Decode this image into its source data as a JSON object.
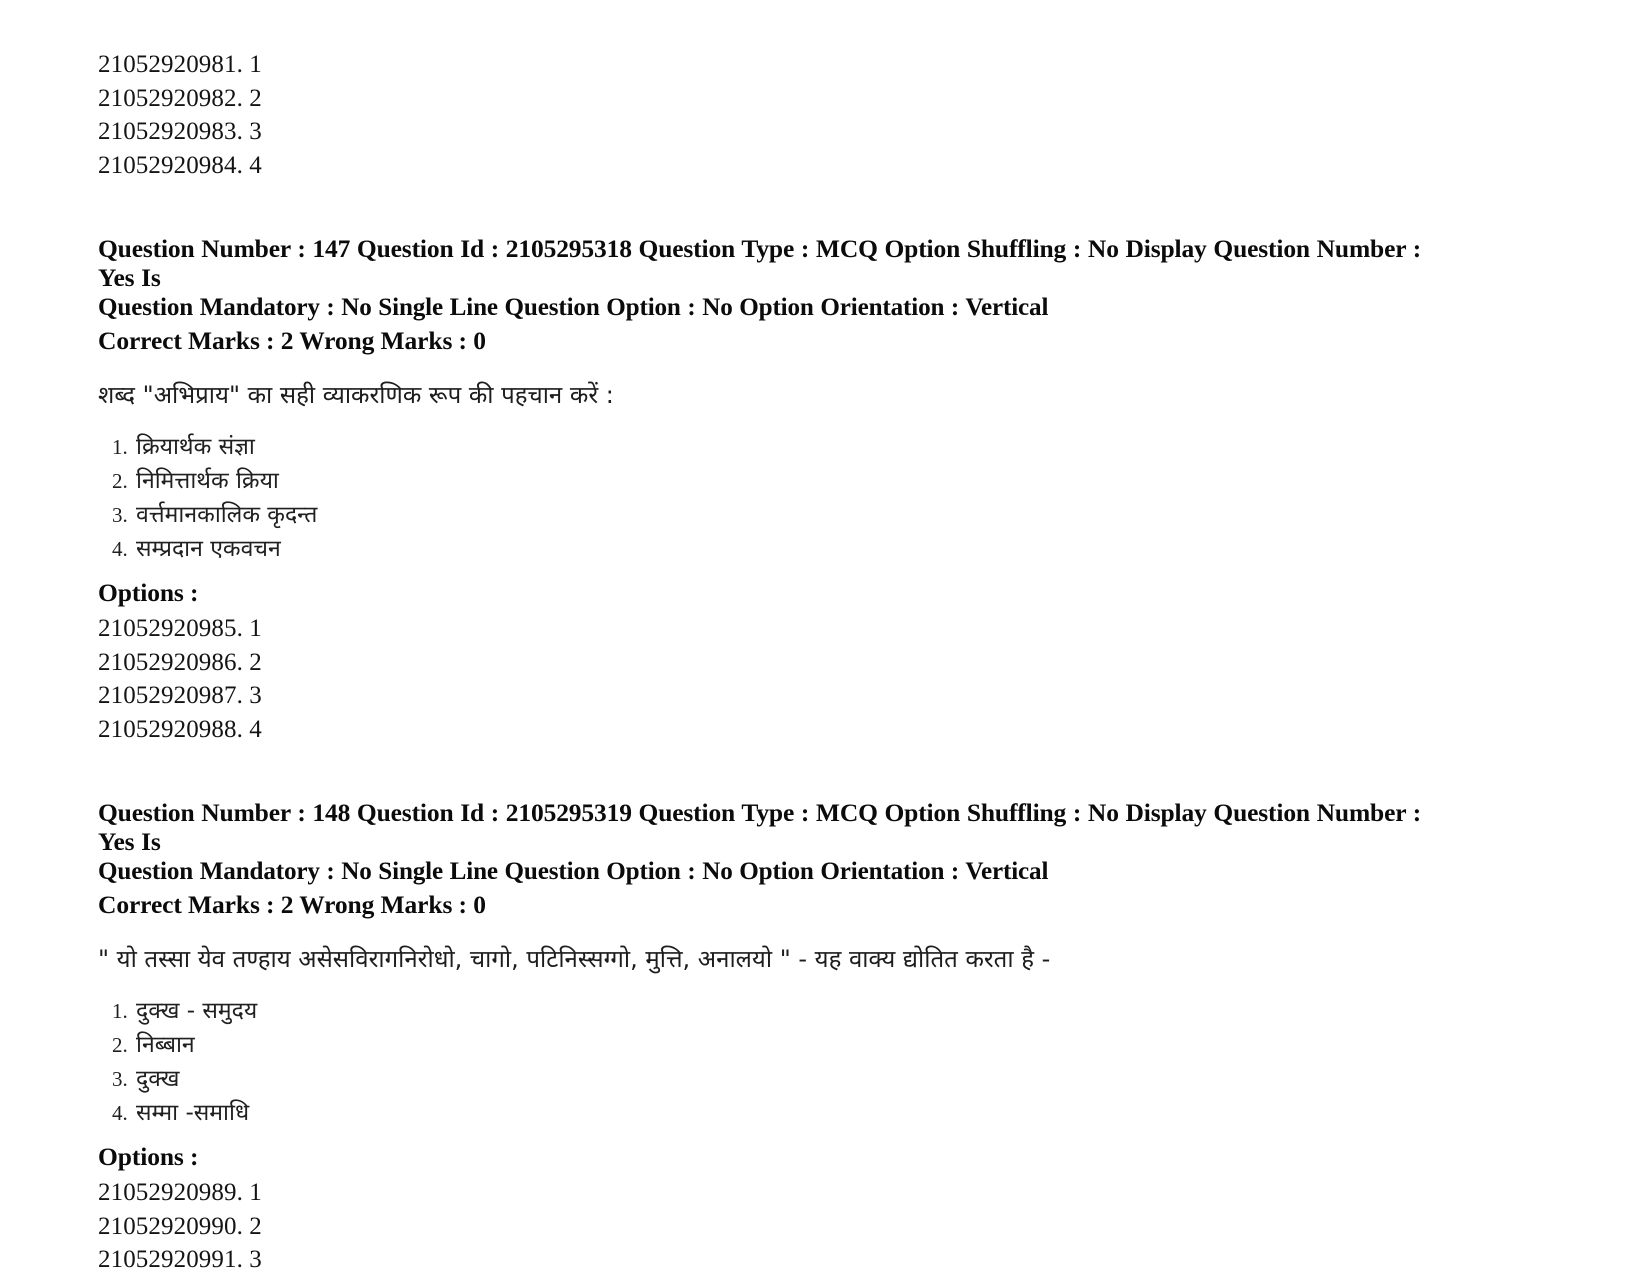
{
  "page": {
    "background": "#ffffff",
    "text_color": "#111111"
  },
  "top_option_ids": [
    "21052920981. 1",
    "21052920982. 2",
    "21052920983. 3",
    "21052920984. 4"
  ],
  "questions": [
    {
      "meta_line_1": "Question Number : 147 Question Id : 2105295318 Question Type : MCQ Option Shuffling : No Display Question Number : Yes Is",
      "meta_line_2": "Question Mandatory : No Single Line Question Option : No Option Orientation : Vertical",
      "marks_line": "Correct Marks : 2 Wrong Marks : 0",
      "question_text": "शब्द \"अभिप्राय\" का सही व्याकरणिक रूप की पहचान करें :",
      "choices": [
        {
          "num": "1.",
          "text": "क्रियार्थक  संज्ञा"
        },
        {
          "num": "2.",
          "text": "निमित्तार्थक क्रिया"
        },
        {
          "num": "3.",
          "text": "वर्त्तमानकालिक कृदन्त"
        },
        {
          "num": "4.",
          "text": "सम्प्रदान एकवचन"
        }
      ],
      "options_label": "Options :",
      "option_ids": [
        "21052920985. 1",
        "21052920986. 2",
        "21052920987. 3",
        "21052920988. 4"
      ]
    },
    {
      "meta_line_1": "Question Number : 148 Question Id : 2105295319 Question Type : MCQ Option Shuffling : No Display Question Number : Yes Is",
      "meta_line_2": "Question Mandatory : No Single Line Question Option : No Option Orientation : Vertical",
      "marks_line": "Correct Marks : 2 Wrong Marks : 0",
      "question_text": "\" यो तस्सा येव तण्हाय असेसविरागनिरोधो, चागो, पटिनिस्सग्गो, मुत्ति, अनालयो \" - यह वाक्य द्योतित करता है -",
      "choices": [
        {
          "num": "1.",
          "text": "दुक्ख - समुदय"
        },
        {
          "num": "2.",
          "text": "निब्बान"
        },
        {
          "num": "3.",
          "text": "दुक्ख"
        },
        {
          "num": "4.",
          "text": "सम्मा -समाधि"
        }
      ],
      "options_label": "Options :",
      "option_ids": [
        "21052920989. 1",
        "21052920990. 2",
        "21052920991. 3"
      ]
    }
  ]
}
